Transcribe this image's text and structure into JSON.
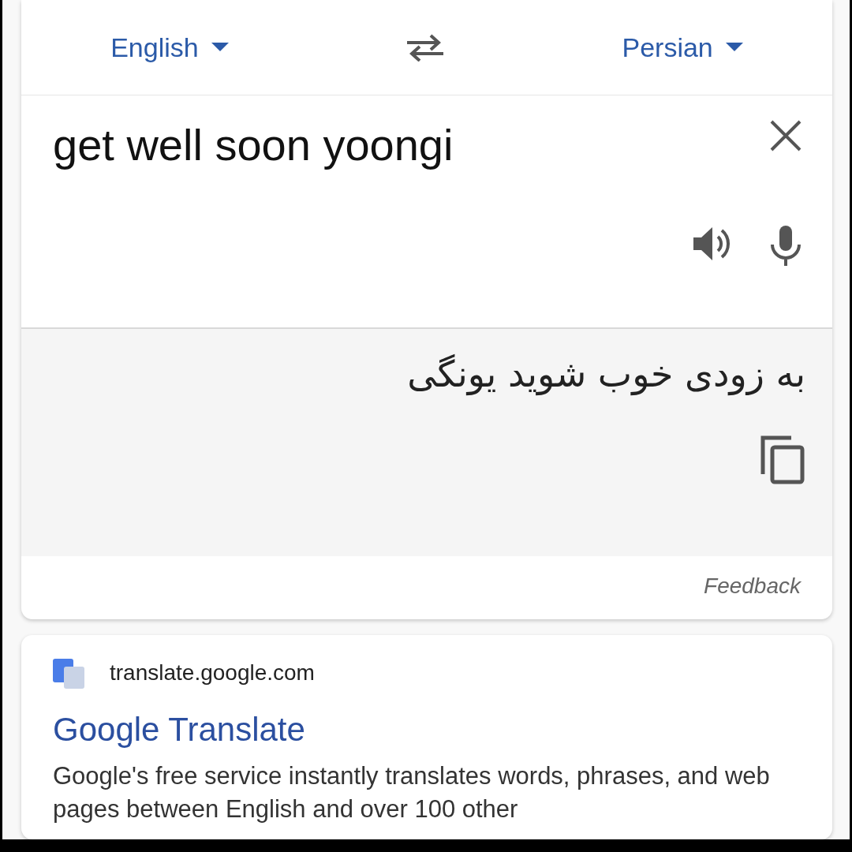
{
  "languages": {
    "source": "English",
    "target": "Persian"
  },
  "input": {
    "value": "get well soon yoongi"
  },
  "output": {
    "text": "به زودی خوب شوید یونگی"
  },
  "feedback": "Feedback",
  "result": {
    "site": "translate.google.com",
    "title": "Google Translate",
    "snippet": "Google's free service instantly translates words, phrases, and web pages between English and over 100 other"
  }
}
